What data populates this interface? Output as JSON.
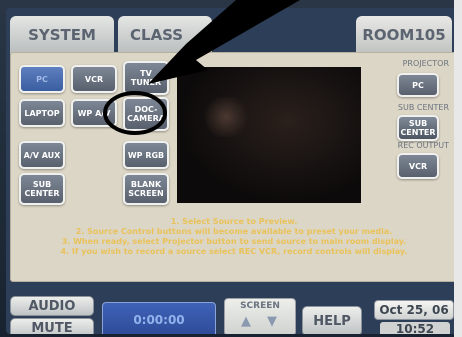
{
  "tabs": {
    "system": "SYSTEM",
    "classroom": "CLASS",
    "room": "ROOM105"
  },
  "sources": {
    "pc": "PC",
    "vcr": "VCR",
    "tv_tuner": "TV TUNER",
    "laptop": "LAPTOP",
    "wp_av": "WP A/V",
    "doc_camera": "DOC-CAMERA",
    "av_aux": "A/V AUX",
    "wp_rgb": "WP RGB",
    "sub_center": "SUB CENTER",
    "blank_screen": "BLANK SCREEN"
  },
  "right_panel": {
    "projector_label": "PROJECTOR",
    "projector_btn": "PC",
    "sub_center_label": "SUB CENTER",
    "sub_center_btn": "SUB CENTER",
    "rec_output_label": "REC OUTPUT",
    "rec_output_btn": "VCR"
  },
  "instructions": [
    "1. Select Source to Preview.",
    "2. Source Control buttons will become available to preset your media.",
    "3. When ready, select Projector button to send source to main room display.",
    "4. If you wish to record a source select REC VCR, record controls will display."
  ],
  "bottom": {
    "audio": "AUDIO",
    "mute": "MUTE",
    "timer": "0:00:00",
    "screen_label": "SCREEN",
    "screen_up_icon": "up-arrow-icon",
    "screen_down_icon": "down-arrow-icon",
    "help": "HELP",
    "date": "Oct 25, 06",
    "time": "10:52"
  },
  "colors": {
    "active_source": "#3a5ea0",
    "instruction_text": "#e9c25a",
    "annotation_circle": "#000000"
  }
}
